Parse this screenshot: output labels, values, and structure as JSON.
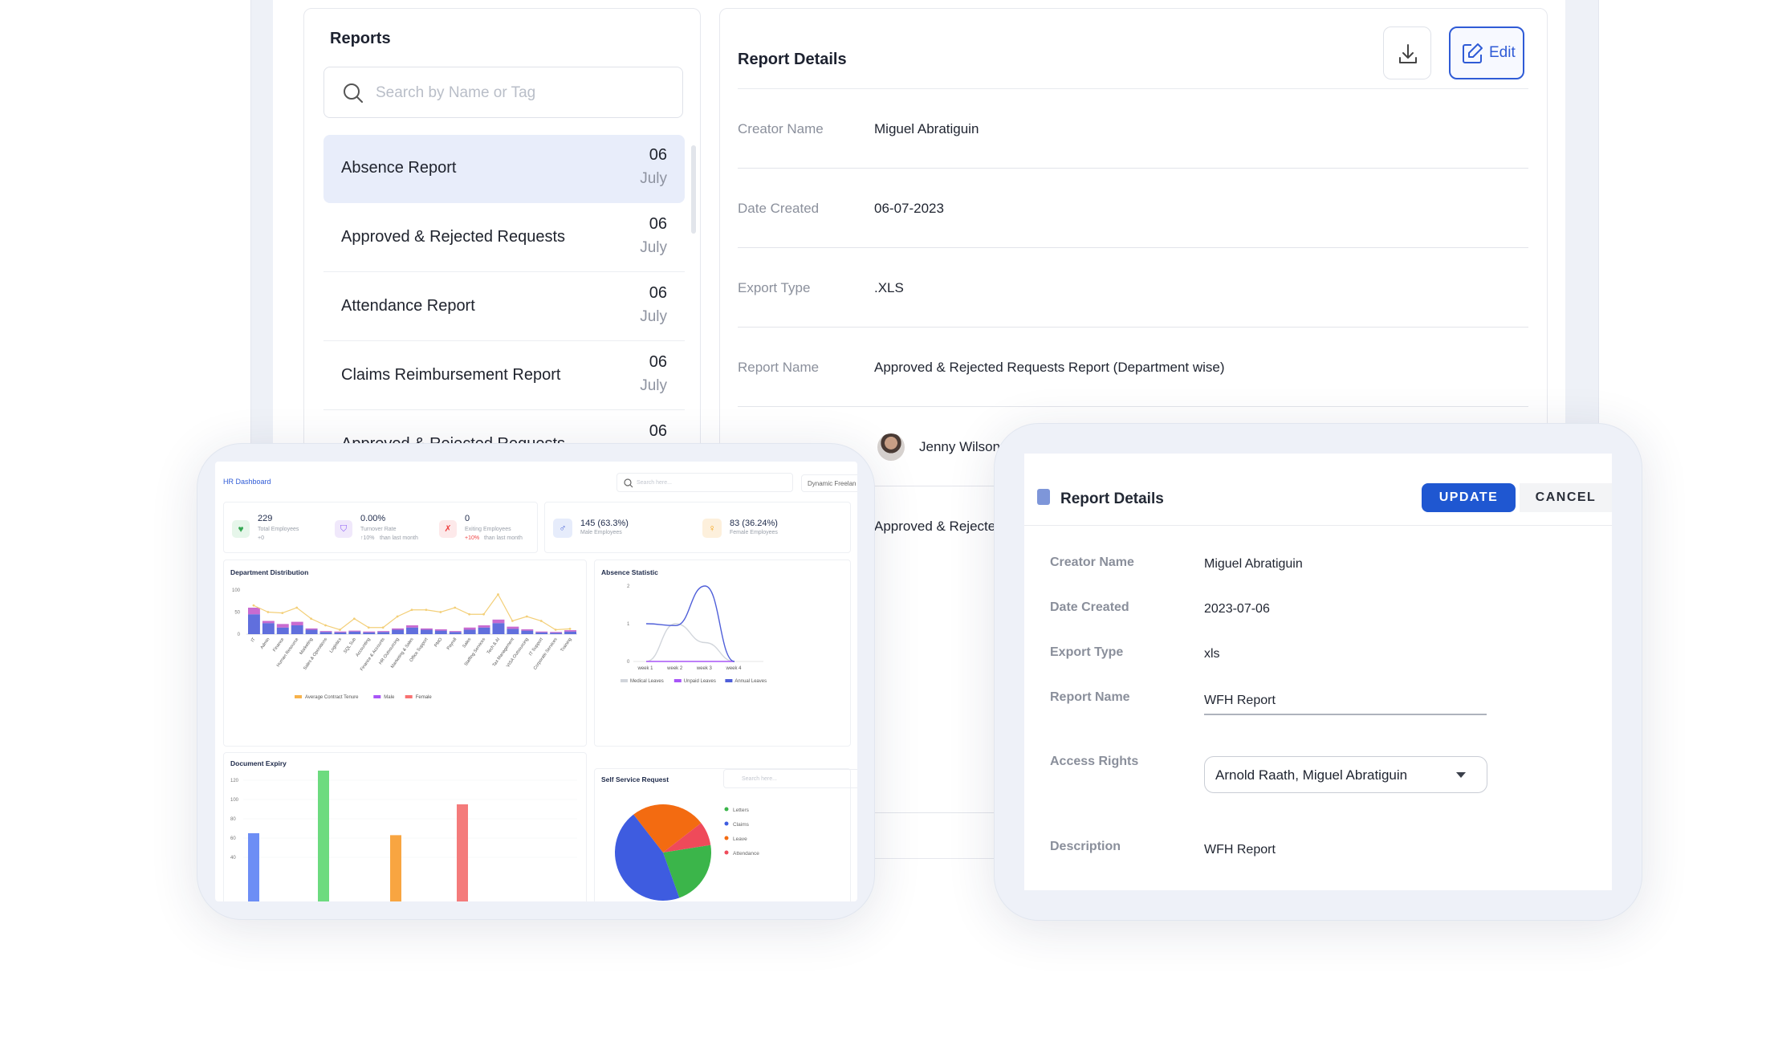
{
  "reports_panel": {
    "title": "Reports",
    "search_placeholder": "Search by Name or Tag",
    "items": [
      {
        "name": "Absence Report",
        "day": "06",
        "month": "July"
      },
      {
        "name": "Approved & Rejected Requests",
        "day": "06",
        "month": "July"
      },
      {
        "name": "Attendance Report",
        "day": "06",
        "month": "July"
      },
      {
        "name": "Claims Reimbursement Report",
        "day": "06",
        "month": "July"
      },
      {
        "name": "Approved & Rejected Requests",
        "day": "06",
        "month": ""
      }
    ]
  },
  "details_panel": {
    "title": "Report Details",
    "edit_label": "Edit",
    "rows": [
      {
        "key": "Creator Name",
        "value": "Miguel Abratiguin"
      },
      {
        "key": "Date Created",
        "value": "06-07-2023"
      },
      {
        "key": "Export Type",
        "value": ".XLS"
      },
      {
        "key": "Report Name",
        "value": "Approved & Rejected Requests Report (Department wise)"
      }
    ],
    "access_user": "Jenny Wilson",
    "description_partial": "Approved & Rejecte"
  },
  "dashboard": {
    "title": "HR Dashboard",
    "search_placeholder": "Search here...",
    "dropdown_label": "Dynamic Freelan",
    "stats": {
      "total_employees": {
        "value": "229",
        "label": "Total Employees",
        "delta": "+0"
      },
      "turnover_rate": {
        "value": "0.00%",
        "label": "Turnover Rate",
        "delta": "↑10%",
        "delta_note": "than last month"
      },
      "exiting_employees": {
        "value": "0",
        "label": "Exiting Employees",
        "delta": "+10%",
        "delta_note": "than last month"
      },
      "male": {
        "value": "145 (63.3%)",
        "label": "Male Employees"
      },
      "female": {
        "value": "83 (36.24%)",
        "label": "Female Employees"
      }
    },
    "dept_title": "Department Distribution",
    "absence_title": "Absence Statistic",
    "doc_title": "Document Expiry",
    "self_title": "Self Service Request",
    "self_search": "Search here..."
  },
  "chart_data": [
    {
      "type": "bar",
      "title": "Department Distribution",
      "ylim": [
        0,
        100
      ],
      "yticks": [
        "100",
        "50",
        "0"
      ],
      "categories": [
        "IT",
        "Admin",
        "Finance",
        "Human Resource",
        "Marketing",
        "Sales & Operations",
        "Logistics",
        "SQL Sub",
        "Accounting",
        "Finance & Accounts",
        "HR Outsourcing",
        "Marketing & Sales",
        "Office Support",
        "PMO",
        "Payroll",
        "Sales",
        "Staffing Services",
        "Tech & AI",
        "Tax Management",
        "VISA Outsourcing",
        "IT Support",
        "Corporate Services",
        "Training"
      ],
      "series": [
        {
          "name": "Average Contract Tenure",
          "type": "line",
          "values": [
            65,
            50,
            48,
            60,
            35,
            20,
            10,
            35,
            15,
            15,
            40,
            55,
            55,
            50,
            60,
            45,
            45,
            90,
            30,
            40,
            30,
            10,
            12
          ]
        },
        {
          "name": "Male",
          "values": [
            45,
            25,
            15,
            20,
            10,
            5,
            4,
            6,
            4,
            5,
            10,
            15,
            10,
            8,
            5,
            10,
            15,
            25,
            12,
            8,
            4,
            3,
            6
          ]
        },
        {
          "name": "Female",
          "values": [
            15,
            5,
            8,
            8,
            3,
            2,
            2,
            2,
            2,
            2,
            3,
            5,
            3,
            3,
            2,
            5,
            5,
            8,
            5,
            3,
            2,
            2,
            3
          ]
        }
      ],
      "legend_colors": {
        "Average Contract Tenure": "#f7b24b",
        "Male": "#a855f7",
        "Female": "#f87171"
      }
    },
    {
      "type": "line",
      "title": "Absence Statistic",
      "x": [
        "week 1",
        "week 2",
        "week 3",
        "week 4"
      ],
      "yticks": [
        "2",
        "1",
        "0"
      ],
      "series": [
        {
          "name": "Medical Leaves",
          "values": [
            0,
            1,
            0.5,
            0
          ]
        },
        {
          "name": "Unpaid Leaves",
          "values": [
            0,
            0,
            0,
            0
          ]
        },
        {
          "name": "Annual Leaves",
          "values": [
            1,
            0.95,
            2,
            0
          ]
        }
      ],
      "legend_colors": {
        "Medical Leaves": "#d1d5db",
        "Unpaid Leaves": "#a855f7",
        "Annual Leaves": "#4f5fd9"
      }
    },
    {
      "type": "bar",
      "title": "Document Expiry",
      "yticks": [
        "120",
        "100",
        "80",
        "60",
        "40"
      ],
      "values": [
        65,
        130,
        63,
        95
      ],
      "colors": [
        "#6d8ef5",
        "#6ddb7f",
        "#f8a541",
        "#f47b7b"
      ]
    },
    {
      "type": "pie",
      "title": "Self Service Request",
      "labels": [
        "Letters",
        "Claims",
        "Leave",
        "Attendance"
      ],
      "values": [
        22,
        45,
        25,
        8
      ],
      "colors": [
        "#3bb54a",
        "#3e5ce0",
        "#f36b11",
        "#ef4a5a"
      ]
    }
  ],
  "front_panel": {
    "title": "Report Details",
    "update_label": "UPDATE",
    "cancel_label": "CANCEL",
    "fields": {
      "creator_name": {
        "key": "Creator Name",
        "value": "Miguel Abratiguin"
      },
      "date_created": {
        "key": "Date Created",
        "value": "2023-07-06"
      },
      "export_type": {
        "key": "Export Type",
        "value": "xls"
      },
      "report_name": {
        "key": "Report Name",
        "value": "WFH Report"
      },
      "access_rights": {
        "key": "Access Rights",
        "value": "Arnold Raath, Miguel Abratiguin"
      },
      "description": {
        "key": "Description",
        "value": "WFH Report"
      }
    }
  }
}
